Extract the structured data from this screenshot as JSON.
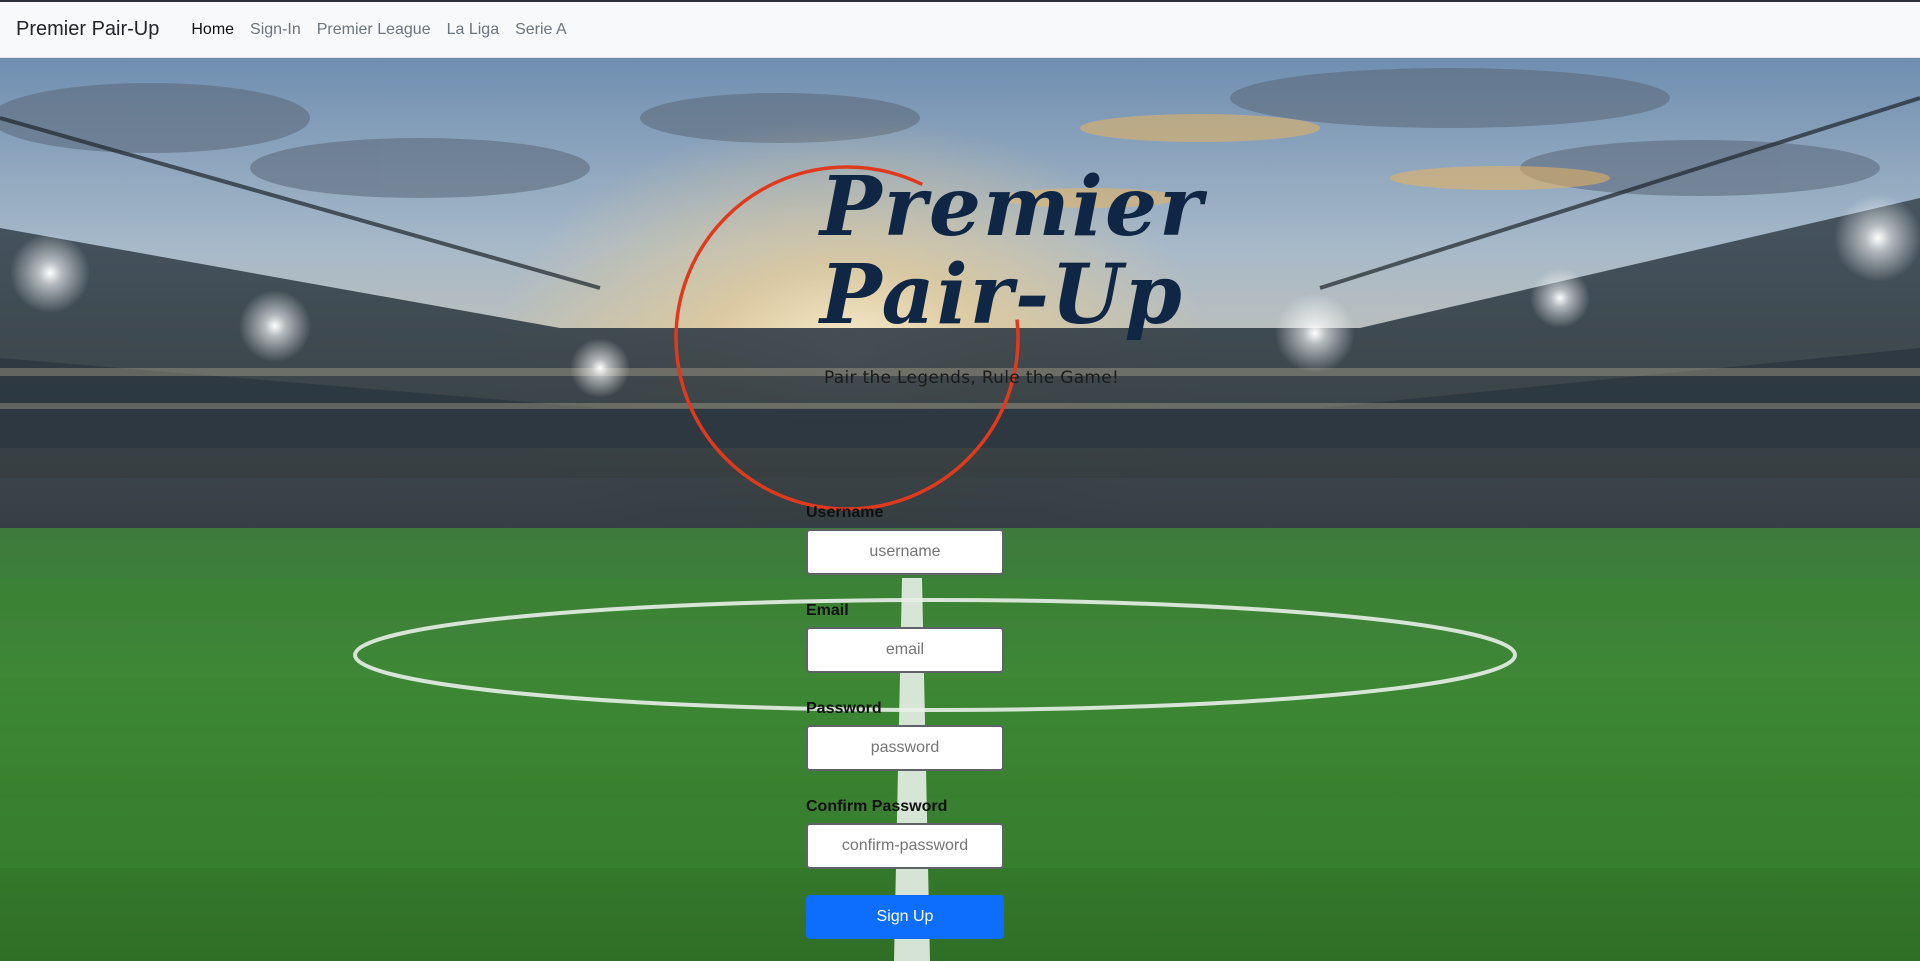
{
  "navbar": {
    "brand": "Premier Pair-Up",
    "links": [
      {
        "label": "Home",
        "active": true
      },
      {
        "label": "Sign-In",
        "active": false
      },
      {
        "label": "Premier League",
        "active": false
      },
      {
        "label": "La Liga",
        "active": false
      },
      {
        "label": "Serie A",
        "active": false
      }
    ]
  },
  "logo": {
    "title_line1": "Premier",
    "title_line2": "Pair-Up",
    "tagline": "Pair the Legends, Rule the Game!",
    "ring_color": "#e03a1e",
    "title_color": "#0f2745"
  },
  "form": {
    "username_label": "Username",
    "username_placeholder": "username",
    "email_label": "Email",
    "email_placeholder": "email",
    "password_label": "Password",
    "password_placeholder": "password",
    "confirm_label": "Confirm Password",
    "confirm_placeholder": "confirm-password",
    "submit_label": "Sign Up"
  },
  "colors": {
    "accent": "#0d6efd",
    "navbar_bg": "#f8f9fa"
  }
}
